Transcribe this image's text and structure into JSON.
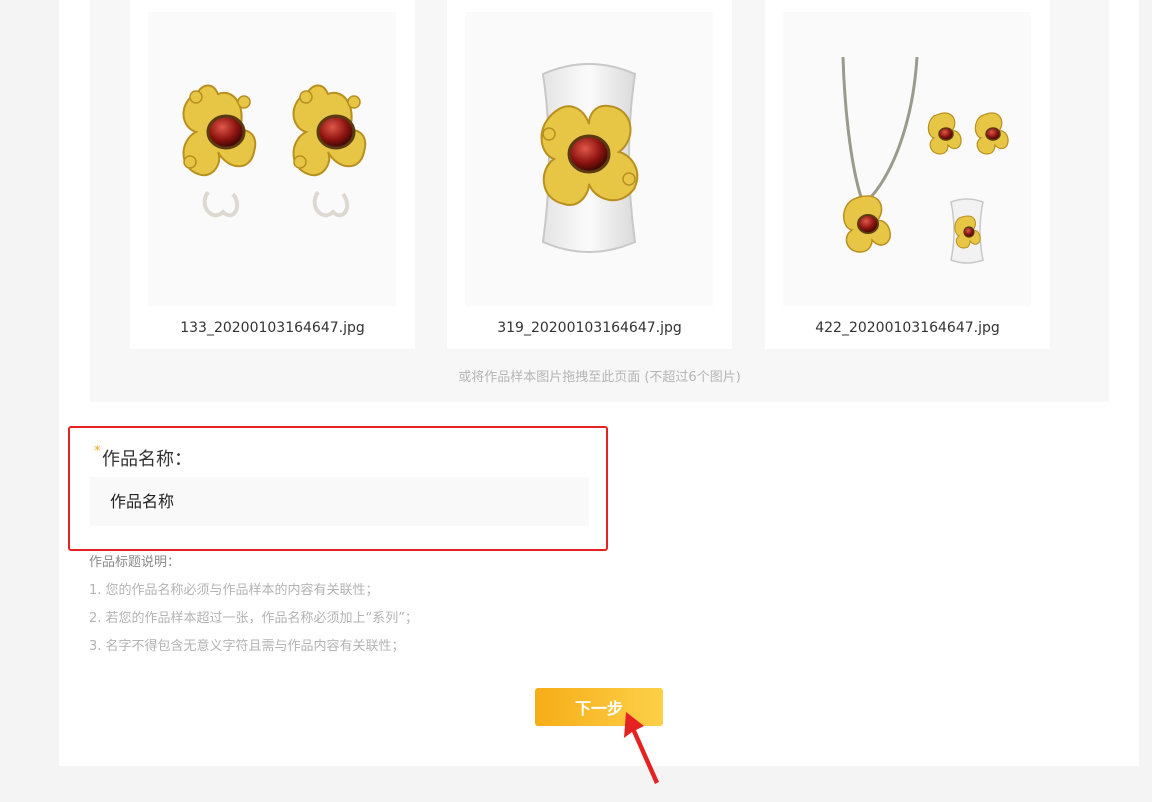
{
  "gallery": {
    "items": [
      {
        "filename": "133_20200103164647.jpg",
        "icon": "earrings-image"
      },
      {
        "filename": "319_20200103164647.jpg",
        "icon": "ring-image"
      },
      {
        "filename": "422_20200103164647.jpg",
        "icon": "jewelry-set-image"
      }
    ],
    "drop_hint": "或将作品样本图片拖拽至此页面 (不超过6个图片)"
  },
  "form": {
    "required_mark": "*",
    "name_label": "作品名称：",
    "name_placeholder": "作品名称"
  },
  "notes": {
    "title": "作品标题说明：",
    "items": [
      "1. 您的作品名称必须与作品样本的内容有关联性；",
      "2. 若您的作品样本超过一张，作品名称必须加上“系列”；",
      "3. 名字不得包含无意义字符且需与作品内容有关联性；"
    ]
  },
  "actions": {
    "next_label": "下一步"
  },
  "colors": {
    "accent": "#f6ad17",
    "highlight_border": "#e52222",
    "annotation_arrow": "#e52222"
  }
}
